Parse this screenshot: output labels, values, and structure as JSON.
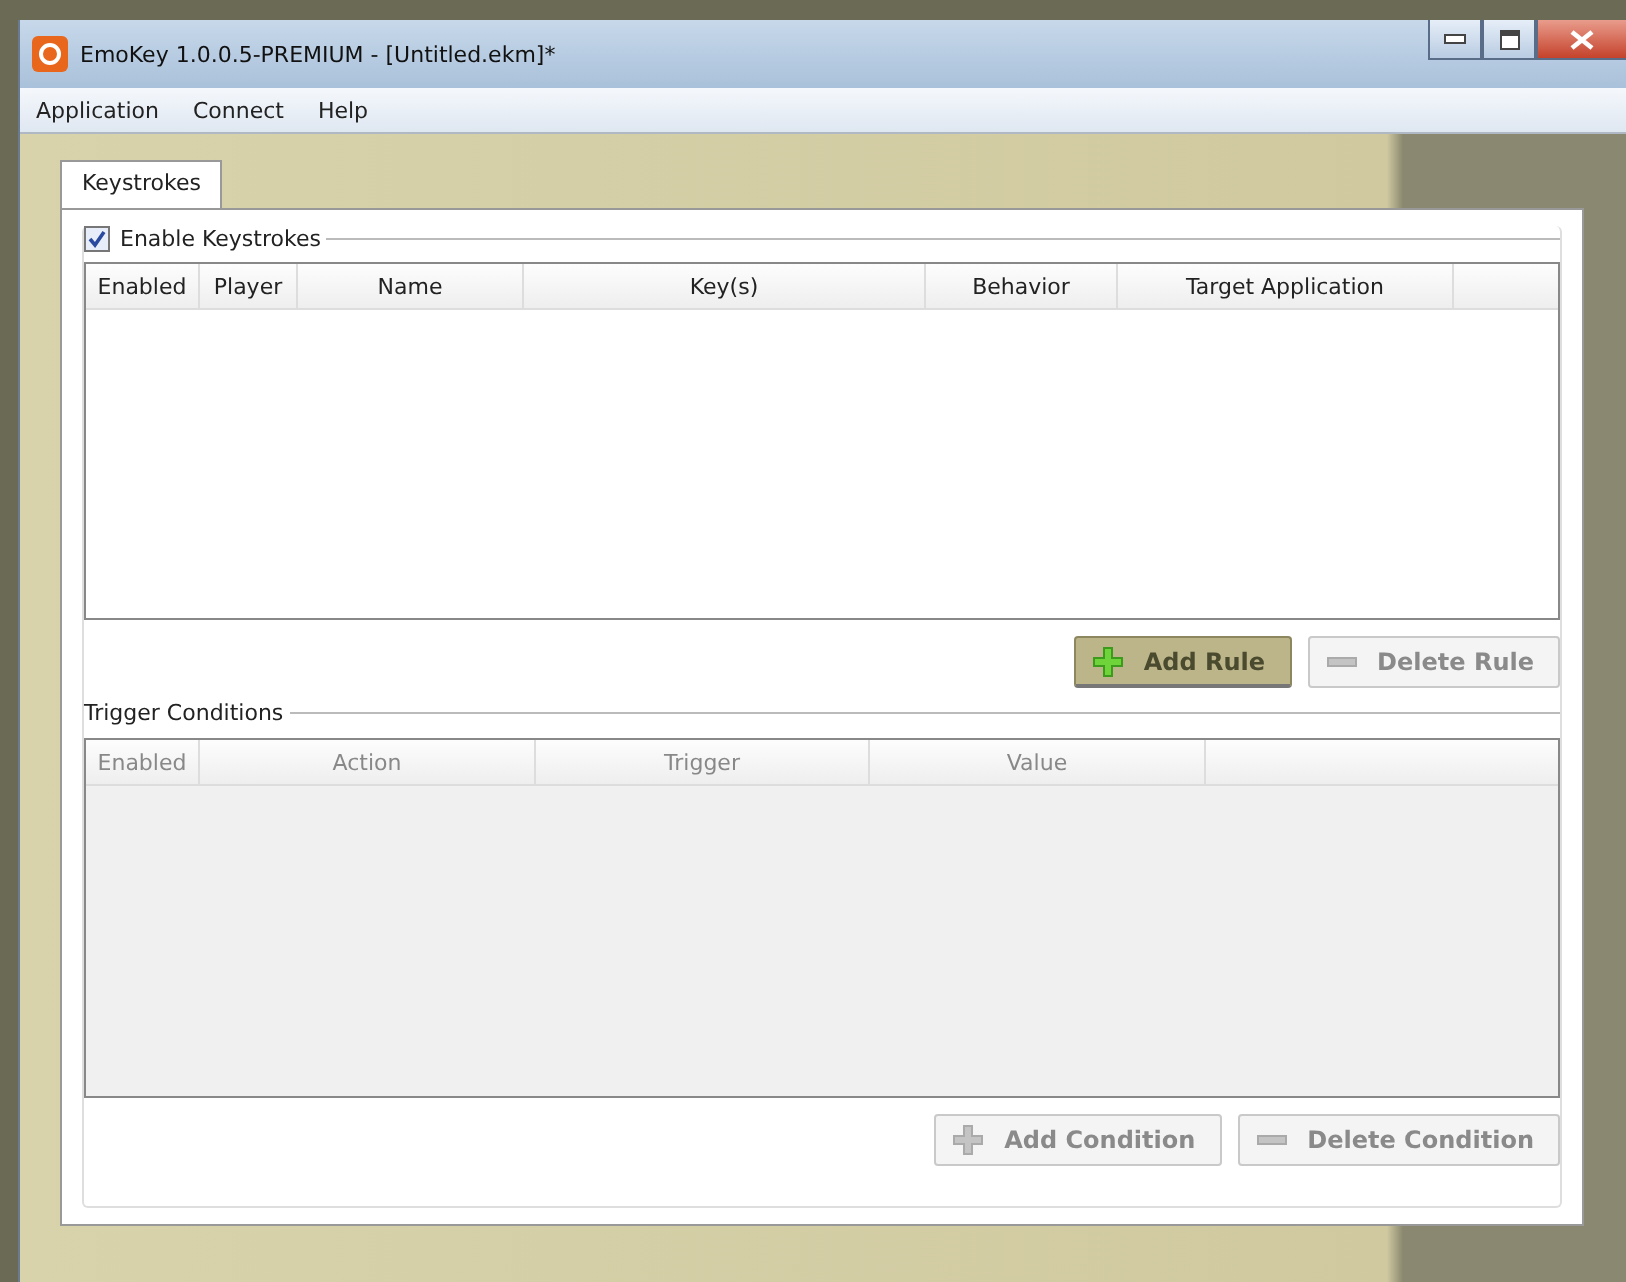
{
  "window": {
    "title": "EmoKey 1.0.0.5-PREMIUM - [Untitled.ekm]*"
  },
  "menu": [
    "Application",
    "Connect",
    "Help"
  ],
  "tabs": [
    {
      "label": "Keystrokes",
      "selected": true
    }
  ],
  "keystrokes": {
    "label": "Enable Keystrokes",
    "checked": true,
    "columns": [
      "Enabled",
      "Player",
      "Name",
      "Key(s)",
      "Behavior",
      "Target Application"
    ],
    "buttons": [
      {
        "kind": "add",
        "label": "Add Rule",
        "disabled": false,
        "hovered": true
      },
      {
        "kind": "delete",
        "label": "Delete Rule",
        "disabled": true,
        "hovered": false
      }
    ]
  },
  "trigger_conditions": {
    "label": "Trigger Conditions",
    "disabled": true,
    "columns": [
      "Enabled",
      "Action",
      "Trigger",
      "Value"
    ],
    "buttons": [
      {
        "kind": "add",
        "label": "Add Condition",
        "disabled": true,
        "hovered": false
      },
      {
        "kind": "delete",
        "label": "Delete Condition",
        "disabled": true,
        "hovered": false
      }
    ]
  }
}
